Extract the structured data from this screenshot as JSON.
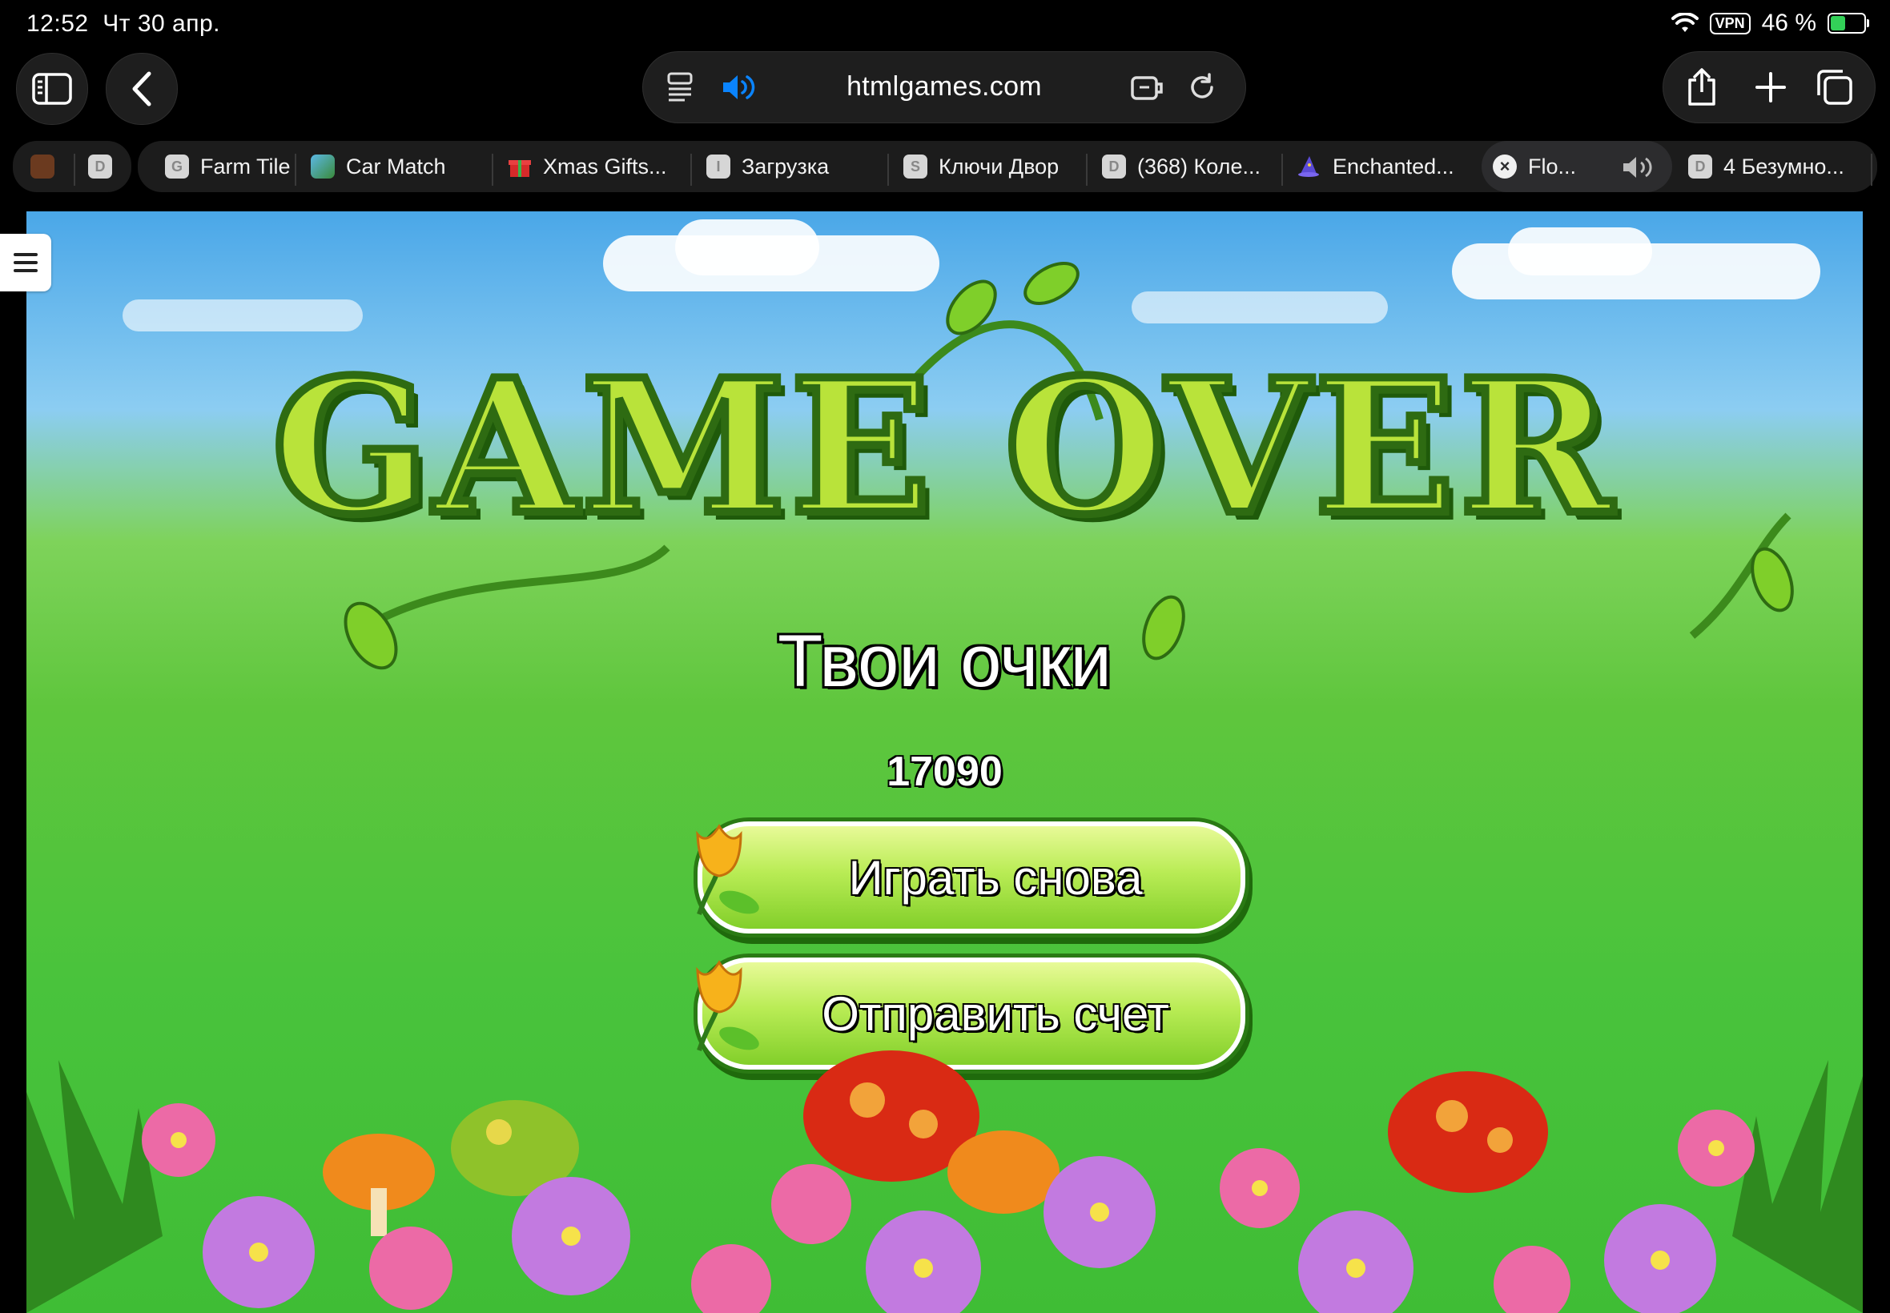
{
  "status_bar": {
    "time": "12:52",
    "date": "Чт 30 апр.",
    "vpn": "VPN",
    "battery": "46 %",
    "battery_level": 0.46
  },
  "toolbar": {
    "sidebar_icon": "sidebar-icon",
    "back_icon": "chevron-left-icon",
    "url": "htmlgames.com",
    "reader_icon": "reader-icon",
    "sound_icon": "speaker-wave-icon",
    "extension_icon": "extension-icon",
    "reload_icon": "reload-icon",
    "share_icon": "share-icon",
    "new_tab_icon": "plus-icon",
    "tabs_icon": "tabs-overview-icon"
  },
  "tabs": [
    {
      "label": "",
      "favicon": ""
    },
    {
      "label": "",
      "favicon": "D"
    },
    {
      "label": "Farm Tile",
      "favicon": "G"
    },
    {
      "label": "Car Match",
      "favicon": ""
    },
    {
      "label": "Xmas Gifts...",
      "favicon": ""
    },
    {
      "label": "Загрузка",
      "favicon": "I"
    },
    {
      "label": "Ключи Двор",
      "favicon": "S"
    },
    {
      "label": "(368) Коле...",
      "favicon": "D"
    },
    {
      "label": "Enchanted...",
      "favicon": ""
    },
    {
      "label": "Flo...",
      "favicon": "",
      "active": true
    },
    {
      "label": "4 Безумно...",
      "favicon": "D"
    }
  ],
  "game": {
    "title": "GAME OVER",
    "score_label": "Твои очки",
    "score": "17090",
    "play_again": "Играть снова",
    "submit_score": "Отправить счет",
    "menu_icon": "hamburger-menu-icon"
  },
  "colors": {
    "accent": "#0a84ff",
    "title_green": "#b9e33a",
    "button_green": "#9edc3c"
  }
}
